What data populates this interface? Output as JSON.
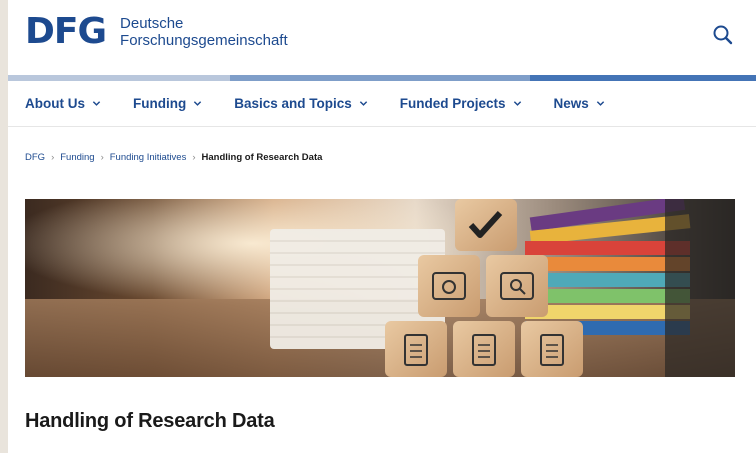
{
  "logo": {
    "mark": "DFG",
    "line1": "Deutsche",
    "line2": "Forschungsgemeinschaft"
  },
  "nav": {
    "items": [
      {
        "label": "About Us"
      },
      {
        "label": "Funding"
      },
      {
        "label": "Basics and Topics"
      },
      {
        "label": "Funded Projects"
      },
      {
        "label": "News"
      }
    ]
  },
  "breadcrumb": {
    "items": [
      "DFG",
      "Funding",
      "Funding Initiatives"
    ],
    "current": "Handling of Research Data"
  },
  "main": {
    "title": "Handling of Research Data"
  },
  "colors": {
    "brand": "#1d4a8f"
  }
}
